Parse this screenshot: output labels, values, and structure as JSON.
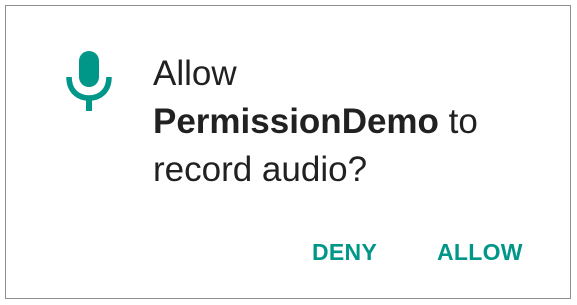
{
  "dialog": {
    "icon": "microphone-icon",
    "accent_color": "#009688",
    "message": {
      "line1": "Allow",
      "app_name": "PermissionDemo",
      "line2_suffix": "to",
      "line3": "record audio?"
    },
    "buttons": {
      "deny_label": "DENY",
      "allow_label": "ALLOW"
    }
  }
}
